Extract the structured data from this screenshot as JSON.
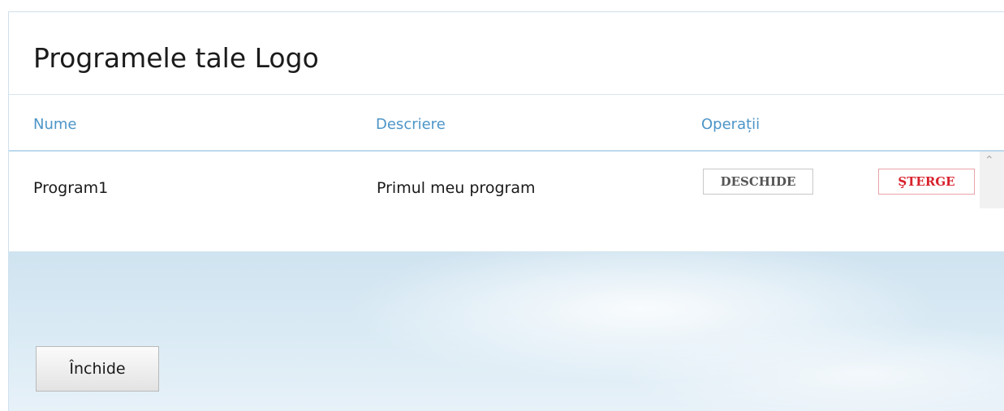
{
  "dialog": {
    "title": "Programele tale Logo"
  },
  "table": {
    "columns": {
      "name": "Nume",
      "description": "Descriere",
      "operations": "Operații"
    },
    "rows": [
      {
        "name": "Program1",
        "description": "Primul meu program",
        "open_label": "DESCHIDE",
        "delete_label": "ŞTERGE"
      }
    ]
  },
  "footer": {
    "close_label": "Închide"
  },
  "icons": {
    "scroll_up": "chevron-up-icon"
  },
  "colors": {
    "header_text": "#4d95c8",
    "delete_text": "#d8202c",
    "footer_bg": "#dbebf5"
  }
}
